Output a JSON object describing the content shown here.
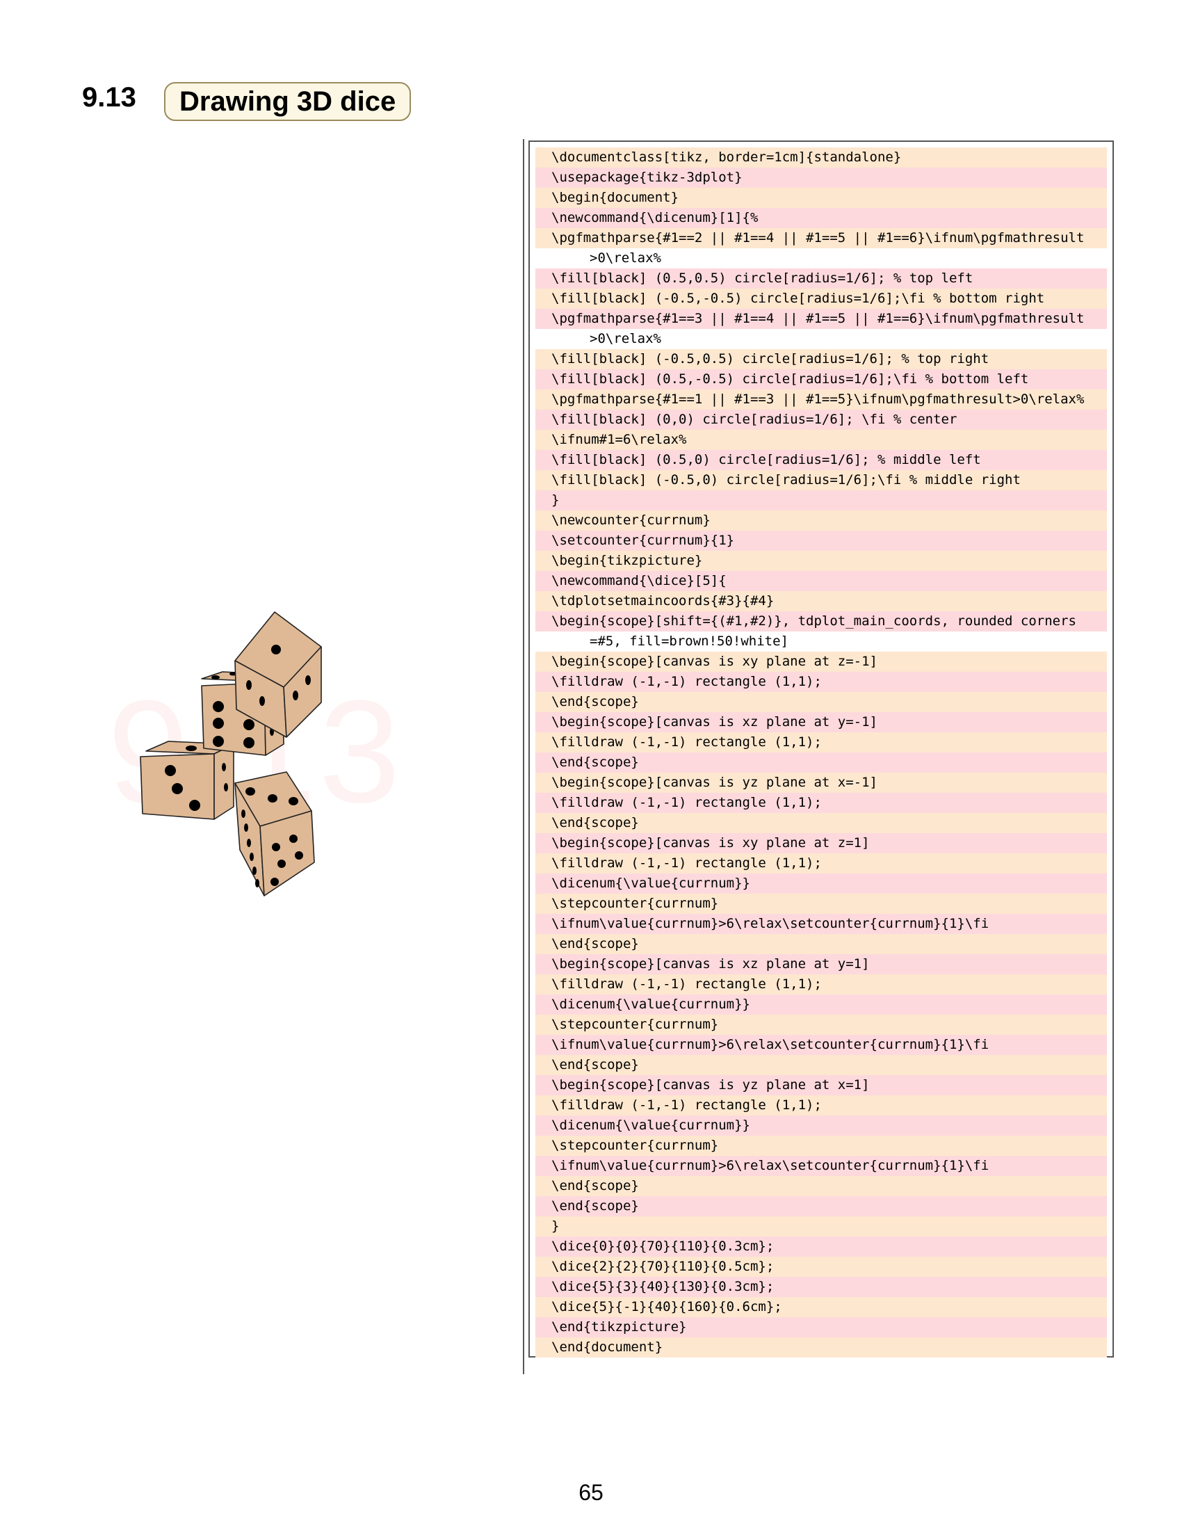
{
  "section": {
    "number": "9.13",
    "title": "Drawing 3D dice"
  },
  "watermark": "9.13",
  "figure": {
    "die_color": "#dfb995",
    "pip_color": "#000000"
  },
  "code_lines": [
    "\\documentclass[tikz, border=1cm]{standalone}",
    "\\usepackage{tikz-3dplot}",
    "\\begin{document}",
    "\\newcommand{\\dicenum}[1]{%",
    "\\pgfmathparse{#1==2 || #1==4 || #1==5 || #1==6}\\ifnum\\pgfmathresult",
    ">0\\relax%",
    "\\fill[black] (0.5,0.5) circle[radius=1/6]; % top left",
    "\\fill[black] (-0.5,-0.5) circle[radius=1/6];\\fi % bottom right",
    "\\pgfmathparse{#1==3 || #1==4 || #1==5 || #1==6}\\ifnum\\pgfmathresult",
    ">0\\relax%",
    "\\fill[black] (-0.5,0.5) circle[radius=1/6]; % top right",
    "\\fill[black] (0.5,-0.5) circle[radius=1/6];\\fi % bottom left",
    "\\pgfmathparse{#1==1 || #1==3 || #1==5}\\ifnum\\pgfmathresult>0\\relax%",
    "\\fill[black] (0,0) circle[radius=1/6]; \\fi % center",
    "\\ifnum#1=6\\relax%",
    "\\fill[black] (0.5,0) circle[radius=1/6]; % middle left",
    "\\fill[black] (-0.5,0) circle[radius=1/6];\\fi % middle right",
    "}",
    "\\newcounter{currnum}",
    "\\setcounter{currnum}{1}",
    "\\begin{tikzpicture}",
    "\\newcommand{\\dice}[5]{",
    "\\tdplotsetmaincoords{#3}{#4}",
    "\\begin{scope}[shift={(#1,#2)}, tdplot_main_coords, rounded corners",
    "=#5, fill=brown!50!white]",
    "\\begin{scope}[canvas is xy plane at z=-1]",
    "\\filldraw (-1,-1) rectangle (1,1);",
    "\\end{scope}",
    "\\begin{scope}[canvas is xz plane at y=-1]",
    "\\filldraw (-1,-1) rectangle (1,1);",
    "\\end{scope}",
    "\\begin{scope}[canvas is yz plane at x=-1]",
    "\\filldraw (-1,-1) rectangle (1,1);",
    "\\end{scope}",
    "\\begin{scope}[canvas is xy plane at z=1]",
    "\\filldraw (-1,-1) rectangle (1,1);",
    "\\dicenum{\\value{currnum}}",
    "\\stepcounter{currnum}",
    "\\ifnum\\value{currnum}>6\\relax\\setcounter{currnum}{1}\\fi",
    "\\end{scope}",
    "\\begin{scope}[canvas is xz plane at y=1]",
    "\\filldraw (-1,-1) rectangle (1,1);",
    "\\dicenum{\\value{currnum}}",
    "\\stepcounter{currnum}",
    "\\ifnum\\value{currnum}>6\\relax\\setcounter{currnum}{1}\\fi",
    "\\end{scope}",
    "\\begin{scope}[canvas is yz plane at x=1]",
    "\\filldraw (-1,-1) rectangle (1,1);",
    "\\dicenum{\\value{currnum}}",
    "\\stepcounter{currnum}",
    "\\ifnum\\value{currnum}>6\\relax\\setcounter{currnum}{1}\\fi",
    "\\end{scope}",
    "\\end{scope}",
    "}",
    "\\dice{0}{0}{70}{110}{0.3cm};",
    "\\dice{2}{2}{70}{110}{0.5cm};",
    "\\dice{5}{3}{40}{130}{0.3cm};",
    "\\dice{5}{-1}{40}{160}{0.6cm};",
    "\\end{tikzpicture}",
    "\\end{document}"
  ],
  "page_number": "65"
}
